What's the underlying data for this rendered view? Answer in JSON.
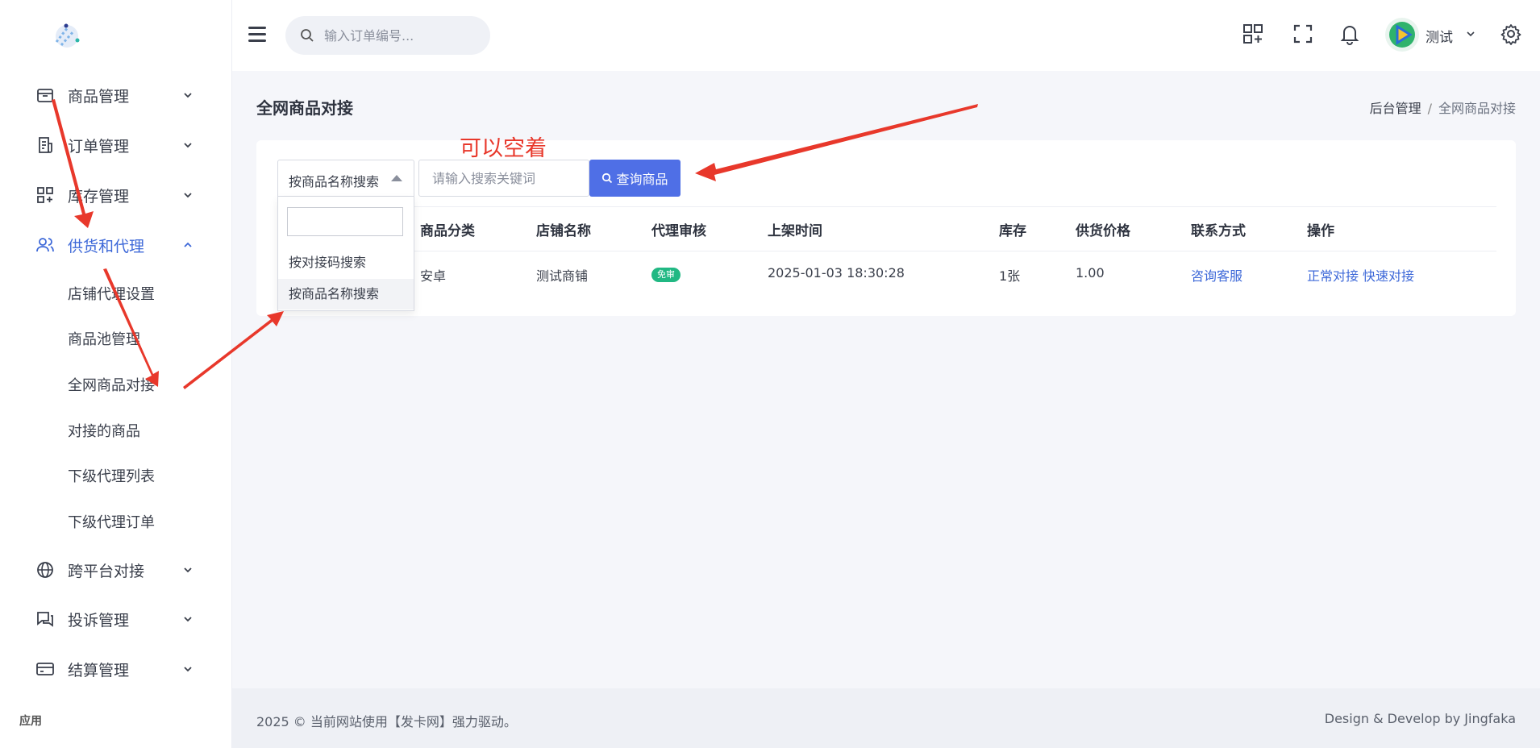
{
  "sidebar": {
    "groups": [
      {
        "label": "商品管理",
        "icon": "box-icon"
      },
      {
        "label": "订单管理",
        "icon": "receipt-icon"
      },
      {
        "label": "库存管理",
        "icon": "grid-plus-icon"
      },
      {
        "label": "供货和代理",
        "icon": "users-icon"
      },
      {
        "label": "跨平台对接",
        "icon": "globe-icon"
      },
      {
        "label": "投诉管理",
        "icon": "chat-icon"
      },
      {
        "label": "结算管理",
        "icon": "card-icon"
      }
    ],
    "sub_items": [
      "店铺代理设置",
      "商品池管理",
      "全网商品对接",
      "对接的商品",
      "下级代理列表",
      "下级代理订单"
    ],
    "footer_label": "应用"
  },
  "header": {
    "search_placeholder": "输入订单编号...",
    "username": "测试"
  },
  "page": {
    "title": "全网商品对接",
    "breadcrumb": [
      "后台管理",
      "全网商品对接"
    ]
  },
  "filter": {
    "select_value": "按商品名称搜索",
    "options": [
      "按对接码搜索",
      "按商品名称搜索"
    ],
    "keyword_placeholder": "请输入搜索关键词",
    "query_label": "查询商品"
  },
  "table": {
    "headers": [
      "商品分类",
      "店铺名称",
      "代理审核",
      "上架时间",
      "库存",
      "供货价格",
      "联系方式",
      "操作"
    ],
    "rows": [
      {
        "category": "安卓",
        "shop": "测试商铺",
        "audit": "免审",
        "time": "2025-01-03 18:30:28",
        "stock": "1张",
        "price": "1.00",
        "contact": "咨询客服",
        "action_normal": "正常对接",
        "action_fast": "快速对接"
      }
    ]
  },
  "annotation": "可以空着",
  "footer": {
    "left": "2025 © 当前网站使用【发卡网】强力驱动。",
    "right": "Design & Develop by Jingfaka"
  },
  "colors": {
    "accent": "#3d68d8",
    "button": "#4f6fe6",
    "badge": "#21b883",
    "annotation": "#e8382b"
  }
}
